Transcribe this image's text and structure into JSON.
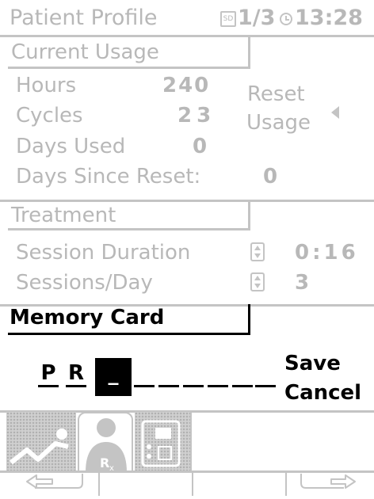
{
  "header": {
    "title": "Patient Profile",
    "sd_badge": "SD",
    "page": "1/3",
    "time": "13:28"
  },
  "usage": {
    "section_title": "Current Usage",
    "hours_label": "Hours",
    "hours_value": "240",
    "cycles_label": "Cycles",
    "cycles_value": "23",
    "days_used_label": "Days Used",
    "days_used_value": "0",
    "days_since_reset_label": "Days Since Reset:",
    "days_since_reset_value": "0",
    "reset_line1": "Reset",
    "reset_line2": "Usage"
  },
  "treatment": {
    "section_title": "Treatment",
    "session_duration_label": "Session Duration",
    "session_duration_value": "0:16",
    "sessions_per_day_label": "Sessions/Day",
    "sessions_per_day_value": "3"
  },
  "memory_card": {
    "section_title": "Memory Card",
    "chars": [
      "P",
      "R",
      "_"
    ],
    "save_label": "Save",
    "cancel_label": "Cancel"
  }
}
